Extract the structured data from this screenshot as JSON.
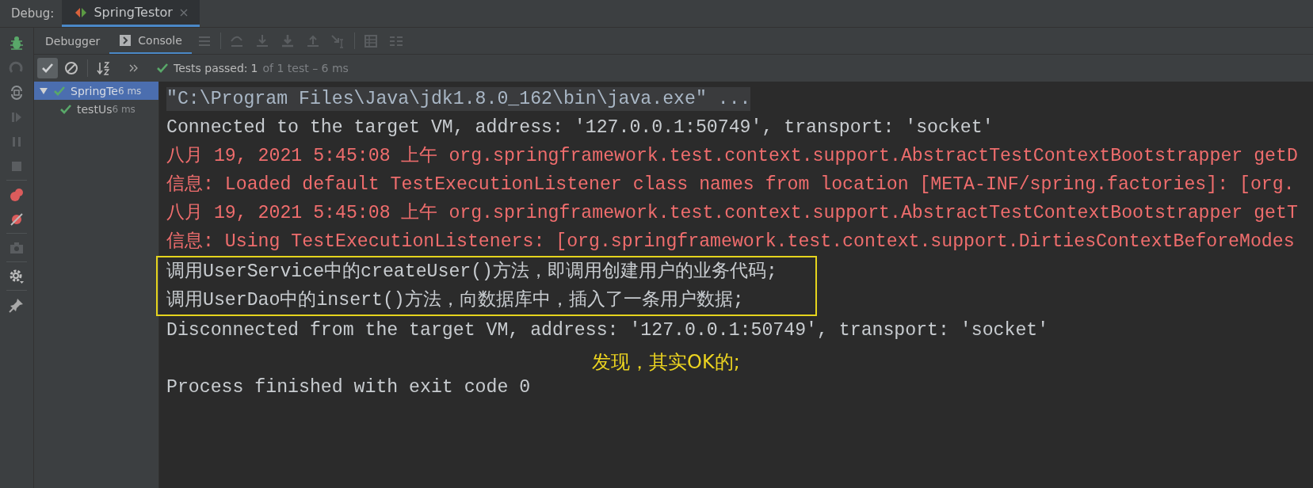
{
  "debug_bar": {
    "label": "Debug:",
    "tabs": [
      {
        "title": "SpringTestor",
        "selected": true
      }
    ]
  },
  "tool_tabs": [
    {
      "label": "Debugger",
      "selected": false,
      "kind": "plain"
    },
    {
      "label": "Console",
      "selected": true,
      "kind": "console"
    }
  ],
  "test_status": {
    "label": "Tests passed:",
    "count": "1",
    "detail": "of 1 test – 6 ms"
  },
  "test_tree": [
    {
      "name": "SpringTe",
      "time": "6 ms",
      "passed": true,
      "selected": true,
      "expanded": true,
      "children": [
        {
          "name": "testUs",
          "time": "6 ms",
          "passed": true,
          "selected": false
        }
      ]
    }
  ],
  "console": {
    "lines": [
      {
        "kind": "command",
        "text": "\"C:\\Program Files\\Java\\jdk1.8.0_162\\bin\\java.exe\" ..."
      },
      {
        "kind": "out",
        "text": "Connected to the target VM, address: '127.0.0.1:50749', transport: 'socket'"
      },
      {
        "kind": "err",
        "text": "八月 19, 2021 5:45:08 上午 org.springframework.test.context.support.AbstractTestContextBootstrapper getD"
      },
      {
        "kind": "err",
        "text": "信息: Loaded default TestExecutionListener class names from location [META-INF/spring.factories]: [org."
      },
      {
        "kind": "err",
        "text": "八月 19, 2021 5:45:08 上午 org.springframework.test.context.support.AbstractTestContextBootstrapper getT"
      },
      {
        "kind": "err",
        "text": "信息: Using TestExecutionListeners: [org.springframework.test.context.support.DirtiesContextBeforeModes"
      },
      {
        "kind": "out",
        "boxed": true,
        "text": "调用UserService中的createUser()方法，即调用创建用户的业务代码;"
      },
      {
        "kind": "out",
        "boxed": true,
        "text": "调用UserDao中的insert()方法，向数据库中，插入了一条用户数据;"
      },
      {
        "kind": "out",
        "text": "Disconnected from the target VM, address: '127.0.0.1:50749', transport: 'socket'"
      },
      {
        "kind": "blank"
      },
      {
        "kind": "out",
        "text": "Process finished with exit code 0"
      }
    ],
    "annotation": "发现，其实OK的;"
  }
}
